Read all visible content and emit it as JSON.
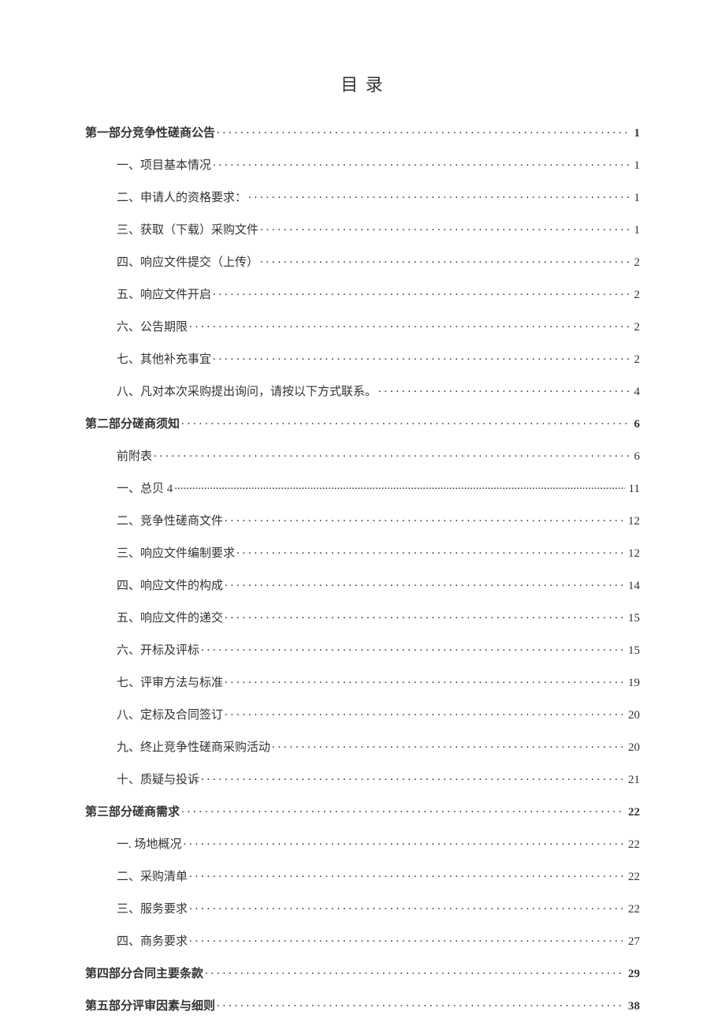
{
  "title": "目 录",
  "entries": [
    {
      "level": 0,
      "bold": true,
      "label": "第一部分竞争性磋商公告",
      "page": "1",
      "dots": "sparse"
    },
    {
      "level": 1,
      "bold": false,
      "label": "一、项目基本情况",
      "page": "1",
      "dots": "sparse"
    },
    {
      "level": 1,
      "bold": false,
      "label": "二、申请人的资格要求：",
      "page": "1",
      "dots": "sparse"
    },
    {
      "level": 1,
      "bold": false,
      "label": "三、获取（下载）采购文件",
      "page": "1",
      "dots": "sparse"
    },
    {
      "level": 1,
      "bold": false,
      "label": "四、响应文件提交（上传）",
      "page": "2",
      "dots": "sparse"
    },
    {
      "level": 1,
      "bold": false,
      "label": "五、响应文件开启",
      "page": "2",
      "dots": "sparse"
    },
    {
      "level": 1,
      "bold": false,
      "label": "六、公告期限",
      "page": "2",
      "dots": "sparse"
    },
    {
      "level": 1,
      "bold": false,
      "label": "七、其他补充事宜",
      "page": "2",
      "dots": "sparse"
    },
    {
      "level": 1,
      "bold": false,
      "label": "八、凡对本次采购提出询问，请按以下方式联系。",
      "page": "4",
      "dots": "sparse"
    },
    {
      "level": 0,
      "bold": true,
      "label": "第二部分磋商须知",
      "page": "6",
      "dots": "sparse"
    },
    {
      "level": 1,
      "bold": false,
      "label": "前附表",
      "page": "6",
      "dots": "sparse"
    },
    {
      "level": 1,
      "bold": false,
      "label": "一、总贝 4",
      "page": "11",
      "dots": "dense"
    },
    {
      "level": 1,
      "bold": false,
      "label": "二、竞争性磋商文件",
      "page": "12",
      "dots": "sparse"
    },
    {
      "level": 1,
      "bold": false,
      "label": "三、响应文件编制要求",
      "page": "12",
      "dots": "sparse"
    },
    {
      "level": 1,
      "bold": false,
      "label": "四、响应文件的构成",
      "page": "14",
      "dots": "sparse"
    },
    {
      "level": 1,
      "bold": false,
      "label": "五、响应文件的递交",
      "page": "15",
      "dots": "sparse"
    },
    {
      "level": 1,
      "bold": false,
      "label": "六、开标及评标",
      "page": "15",
      "dots": "sparse"
    },
    {
      "level": 1,
      "bold": false,
      "label": "七、评审方法与标准",
      "page": "19",
      "dots": "sparse"
    },
    {
      "level": 1,
      "bold": false,
      "label": "八、定标及合同签订",
      "page": "20",
      "dots": "sparse"
    },
    {
      "level": 1,
      "bold": false,
      "label": "九、终止竞争性磋商采购活动",
      "page": "20",
      "dots": "sparse"
    },
    {
      "level": 1,
      "bold": false,
      "label": "十、质疑与投诉",
      "page": "21",
      "dots": "sparse"
    },
    {
      "level": 0,
      "bold": true,
      "label": "第三部分磋商需求",
      "page": "22",
      "dots": "sparse"
    },
    {
      "level": 1,
      "bold": false,
      "label": "一. 场地概况",
      "page": "22",
      "dots": "sparse"
    },
    {
      "level": 1,
      "bold": false,
      "label": "二、采购清单",
      "page": "22",
      "dots": "sparse"
    },
    {
      "level": 1,
      "bold": false,
      "label": "三、服务要求",
      "page": "22",
      "dots": "sparse"
    },
    {
      "level": 1,
      "bold": false,
      "label": "四、商务要求",
      "page": "27",
      "dots": "sparse"
    },
    {
      "level": 0,
      "bold": true,
      "label": "第四部分合同主要条款",
      "page": "29",
      "dots": "sparse"
    },
    {
      "level": 0,
      "bold": true,
      "label": "第五部分评审因素与细则",
      "page": "38",
      "dots": "sparse"
    }
  ]
}
